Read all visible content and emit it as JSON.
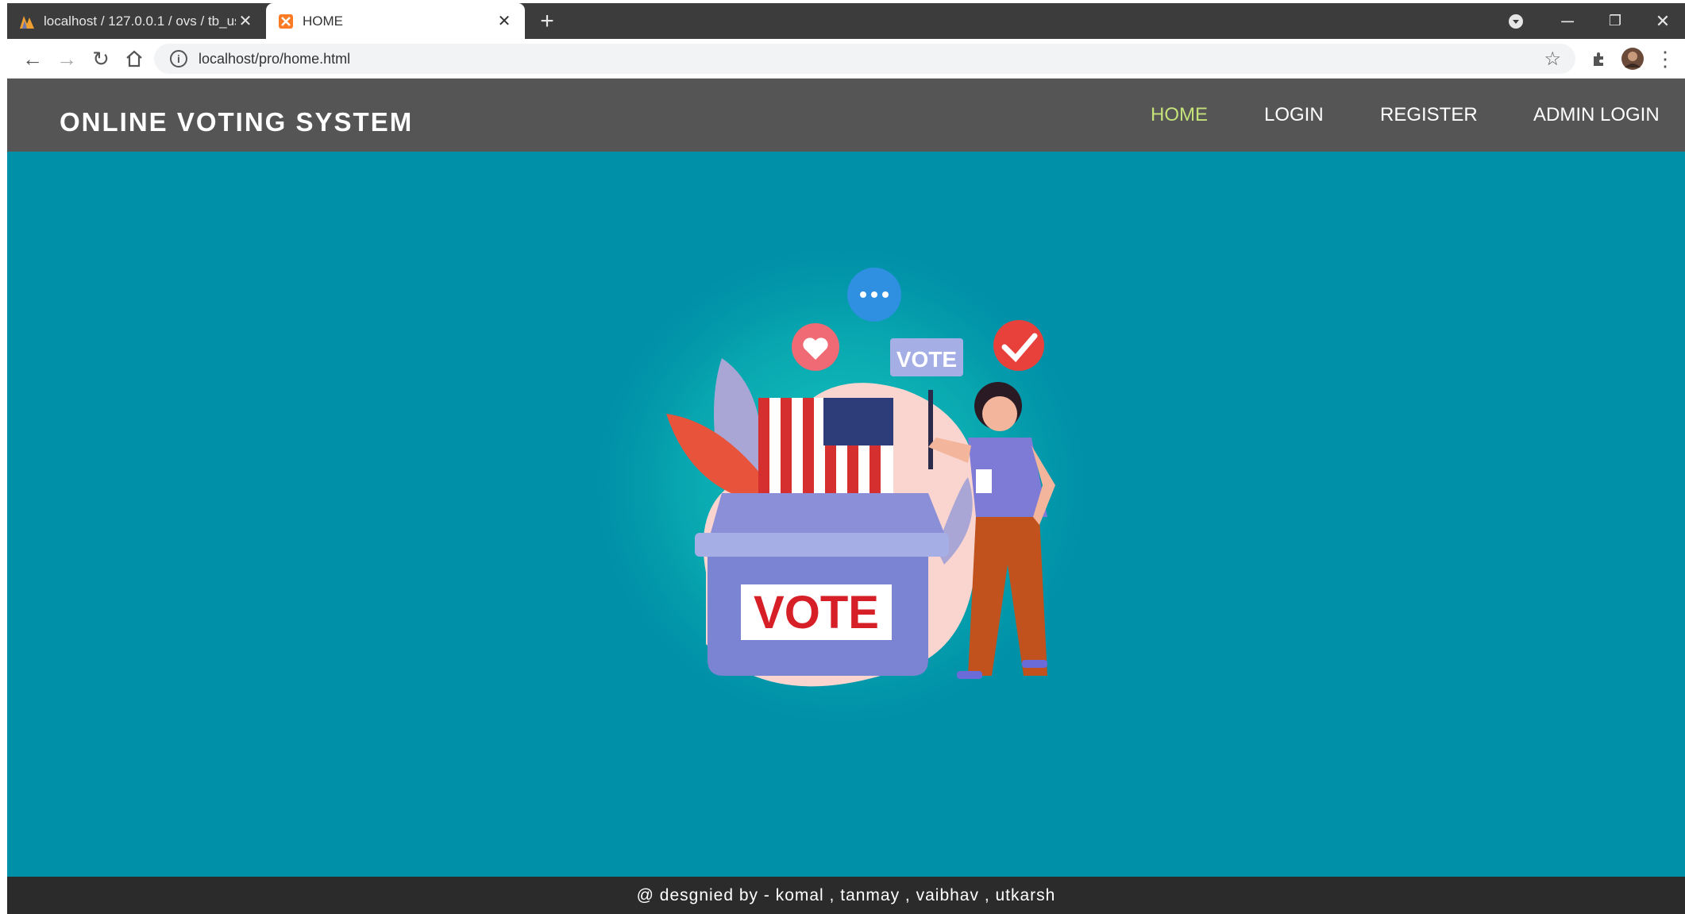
{
  "browser": {
    "tabs": [
      {
        "title": "localhost / 127.0.0.1 / ovs / tb_us",
        "favicon": "phpmyadmin-icon",
        "active": false
      },
      {
        "title": "HOME",
        "favicon": "xampp-icon",
        "active": true
      }
    ],
    "url": "localhost/pro/home.html"
  },
  "header": {
    "brand": "ONLINE VOTING SYSTEM",
    "nav": [
      {
        "label": "HOME",
        "active": true
      },
      {
        "label": "LOGIN",
        "active": false
      },
      {
        "label": "REGISTER",
        "active": false
      },
      {
        "label": "ADMIN LOGIN",
        "active": false
      }
    ]
  },
  "hero": {
    "ballot_box_label": "VOTE",
    "sign_label": "VOTE"
  },
  "footer": {
    "text": "@ desgnied by - komal , tanmay , vaibhav , utkarsh"
  },
  "colors": {
    "header_bg": "#555555",
    "hero_bg": "#0090a8",
    "footer_bg": "#2b2b2b",
    "nav_active": "#c5e17a"
  }
}
